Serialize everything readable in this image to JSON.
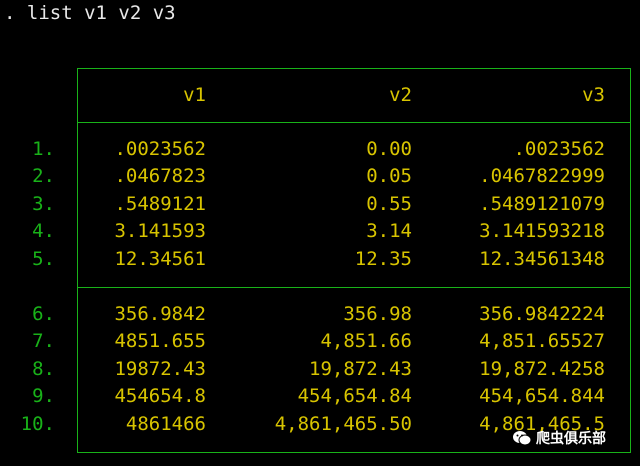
{
  "command": ". list v1 v2 v3",
  "columns": [
    "v1",
    "v2",
    "v3"
  ],
  "rows": [
    {
      "n": "1.",
      "v1": ".0023562",
      "v2": "0.00",
      "v3": ".0023562"
    },
    {
      "n": "2.",
      "v1": ".0467823",
      "v2": "0.05",
      "v3": ".0467822999"
    },
    {
      "n": "3.",
      "v1": ".5489121",
      "v2": "0.55",
      "v3": ".5489121079"
    },
    {
      "n": "4.",
      "v1": "3.141593",
      "v2": "3.14",
      "v3": "3.141593218"
    },
    {
      "n": "5.",
      "v1": "12.34561",
      "v2": "12.35",
      "v3": "12.34561348"
    },
    {
      "n": "6.",
      "v1": "356.9842",
      "v2": "356.98",
      "v3": "356.9842224"
    },
    {
      "n": "7.",
      "v1": "4851.655",
      "v2": "4,851.66",
      "v3": "4,851.65527"
    },
    {
      "n": "8.",
      "v1": "19872.43",
      "v2": "19,872.43",
      "v3": "19,872.4258"
    },
    {
      "n": "9.",
      "v1": "454654.8",
      "v2": "454,654.84",
      "v3": "454,654.844"
    },
    {
      "n": "10.",
      "v1": "4861466",
      "v2": "4,861,465.50",
      "v3": "4,861,465.5"
    }
  ],
  "watermark": {
    "text": "爬虫俱乐部",
    "icon": "wechat-icon"
  },
  "colors": {
    "background": "#000000",
    "border": "#19b219",
    "row_number": "#19b219",
    "value": "#d8c400",
    "command": "#e8e8e8"
  }
}
